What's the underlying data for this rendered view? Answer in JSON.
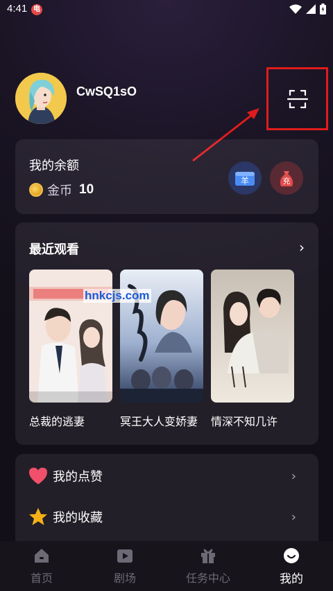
{
  "status_bar": {
    "time": "4:41",
    "app_badge": "电"
  },
  "profile": {
    "username": "CwSQ1sO"
  },
  "balance": {
    "title": "我的余额",
    "coin_label": "金币",
    "coin_value": "10",
    "wallet_icon_text": "羊",
    "recharge_icon_text": "充"
  },
  "recent": {
    "title": "最近观看",
    "items": [
      {
        "title": "总裁的逃妻"
      },
      {
        "title": "冥王大人变娇妻"
      },
      {
        "title": "情深不知几许"
      }
    ]
  },
  "watermark": "hnkcjs.com",
  "menu": {
    "items": [
      {
        "label": "我的点赞",
        "icon": "heart-icon"
      },
      {
        "label": "我的收藏",
        "icon": "star-icon"
      }
    ]
  },
  "nav": {
    "items": [
      {
        "label": "首页",
        "icon": "home-icon"
      },
      {
        "label": "剧场",
        "icon": "play-icon"
      },
      {
        "label": "任务中心",
        "icon": "gift-icon"
      },
      {
        "label": "我的",
        "icon": "profile-icon"
      }
    ],
    "active_index": 3
  },
  "colors": {
    "highlight": "#e01c1c",
    "accent_blue": "#1c5bd8"
  }
}
